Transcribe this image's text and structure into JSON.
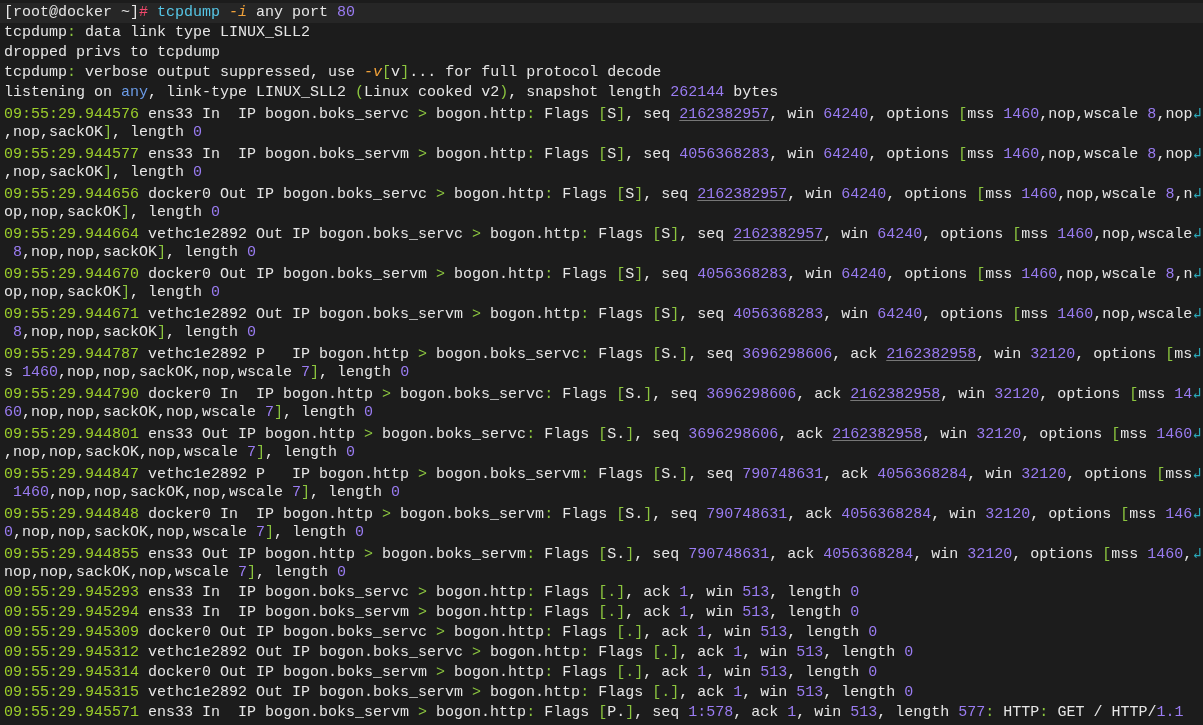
{
  "terminal": {
    "lines": [
      [
        {
          "kind": "plain",
          "text": "[root@docker ~]"
        },
        {
          "kind": "prompt",
          "text": "#"
        },
        {
          "kind": "command",
          "text": " tcpdump"
        },
        {
          "kind": "flag",
          "text": " -i"
        },
        {
          "kind": "plain",
          "text": " any port "
        },
        {
          "kind": "num",
          "text": "80"
        }
      ],
      [
        {
          "kind": "plain",
          "text": "tcpdump"
        },
        {
          "kind": "sym",
          "text": ":"
        },
        {
          "kind": "plain",
          "text": " data link type LINUX_SLL2"
        }
      ],
      [
        {
          "kind": "plain",
          "text": "dropped privs to tcpdump"
        }
      ],
      [
        {
          "kind": "plain",
          "text": "tcpdump"
        },
        {
          "kind": "sym",
          "text": ":"
        },
        {
          "kind": "plain",
          "text": " verbose output suppressed, use "
        },
        {
          "kind": "flag",
          "text": "-v"
        },
        {
          "kind": "sym",
          "text": "["
        },
        {
          "kind": "plain",
          "text": "v"
        },
        {
          "kind": "sym",
          "text": "]"
        },
        {
          "kind": "plain",
          "text": "... for full protocol decode"
        }
      ],
      [
        {
          "kind": "plain",
          "text": "listening on "
        },
        {
          "kind": "keyword",
          "text": "any"
        },
        {
          "kind": "plain",
          "text": ", link-type LINUX_SLL2 "
        },
        {
          "kind": "sym",
          "text": "("
        },
        {
          "kind": "plain",
          "text": "Linux cooked v2"
        },
        {
          "kind": "sym",
          "text": ")"
        },
        {
          "kind": "plain",
          "text": ", snapshot length "
        },
        {
          "kind": "num",
          "text": "262144"
        },
        {
          "kind": "plain",
          "text": " bytes"
        }
      ],
      [
        {
          "kind": "time",
          "text": "09:55:29.944576"
        },
        {
          "kind": "plain",
          "text": " ens33 In  IP bogon.boks_servc "
        },
        {
          "kind": "sym",
          "text": ">"
        },
        {
          "kind": "plain",
          "text": " bogon.http"
        },
        {
          "kind": "sym",
          "text": ":"
        },
        {
          "kind": "plain",
          "text": " Flags "
        },
        {
          "kind": "sym",
          "text": "["
        },
        {
          "kind": "plain",
          "text": "S"
        },
        {
          "kind": "sym",
          "text": "]"
        },
        {
          "kind": "plain",
          "text": ", seq "
        },
        {
          "kind": "link",
          "text": "2162382957"
        },
        {
          "kind": "plain",
          "text": ", win "
        },
        {
          "kind": "num",
          "text": "64240"
        },
        {
          "kind": "plain",
          "text": ", options "
        },
        {
          "kind": "sym",
          "text": "["
        },
        {
          "kind": "plain",
          "text": "mss "
        },
        {
          "kind": "num",
          "text": "1460"
        },
        {
          "kind": "plain",
          "text": ",nop,wscale "
        },
        {
          "kind": "num",
          "text": "8"
        },
        {
          "kind": "plain",
          "text": ",nop"
        },
        {
          "kind": "wrap",
          "text": "↲"
        }
      ],
      [
        {
          "kind": "plain",
          "text": ",nop,sackOK"
        },
        {
          "kind": "sym",
          "text": "]"
        },
        {
          "kind": "plain",
          "text": ", length "
        },
        {
          "kind": "num",
          "text": "0"
        }
      ],
      [
        {
          "kind": "time",
          "text": "09:55:29.944577"
        },
        {
          "kind": "plain",
          "text": " ens33 In  IP bogon.boks_servm "
        },
        {
          "kind": "sym",
          "text": ">"
        },
        {
          "kind": "plain",
          "text": " bogon.http"
        },
        {
          "kind": "sym",
          "text": ":"
        },
        {
          "kind": "plain",
          "text": " Flags "
        },
        {
          "kind": "sym",
          "text": "["
        },
        {
          "kind": "plain",
          "text": "S"
        },
        {
          "kind": "sym",
          "text": "]"
        },
        {
          "kind": "plain",
          "text": ", seq "
        },
        {
          "kind": "num",
          "text": "4056368283"
        },
        {
          "kind": "plain",
          "text": ", win "
        },
        {
          "kind": "num",
          "text": "64240"
        },
        {
          "kind": "plain",
          "text": ", options "
        },
        {
          "kind": "sym",
          "text": "["
        },
        {
          "kind": "plain",
          "text": "mss "
        },
        {
          "kind": "num",
          "text": "1460"
        },
        {
          "kind": "plain",
          "text": ",nop,wscale "
        },
        {
          "kind": "num",
          "text": "8"
        },
        {
          "kind": "plain",
          "text": ",nop"
        },
        {
          "kind": "wrap",
          "text": "↲"
        }
      ],
      [
        {
          "kind": "plain",
          "text": ",nop,sackOK"
        },
        {
          "kind": "sym",
          "text": "]"
        },
        {
          "kind": "plain",
          "text": ", length "
        },
        {
          "kind": "num",
          "text": "0"
        }
      ],
      [
        {
          "kind": "time",
          "text": "09:55:29.944656"
        },
        {
          "kind": "plain",
          "text": " docker0 Out IP bogon.boks_servc "
        },
        {
          "kind": "sym",
          "text": ">"
        },
        {
          "kind": "plain",
          "text": " bogon.http"
        },
        {
          "kind": "sym",
          "text": ":"
        },
        {
          "kind": "plain",
          "text": " Flags "
        },
        {
          "kind": "sym",
          "text": "["
        },
        {
          "kind": "plain",
          "text": "S"
        },
        {
          "kind": "sym",
          "text": "]"
        },
        {
          "kind": "plain",
          "text": ", seq "
        },
        {
          "kind": "link",
          "text": "2162382957"
        },
        {
          "kind": "plain",
          "text": ", win "
        },
        {
          "kind": "num",
          "text": "64240"
        },
        {
          "kind": "plain",
          "text": ", options "
        },
        {
          "kind": "sym",
          "text": "["
        },
        {
          "kind": "plain",
          "text": "mss "
        },
        {
          "kind": "num",
          "text": "1460"
        },
        {
          "kind": "plain",
          "text": ",nop,wscale "
        },
        {
          "kind": "num",
          "text": "8"
        },
        {
          "kind": "plain",
          "text": ",n"
        },
        {
          "kind": "wrap",
          "text": "↲"
        }
      ],
      [
        {
          "kind": "plain",
          "text": "op,nop,sackOK"
        },
        {
          "kind": "sym",
          "text": "]"
        },
        {
          "kind": "plain",
          "text": ", length "
        },
        {
          "kind": "num",
          "text": "0"
        }
      ],
      [
        {
          "kind": "time",
          "text": "09:55:29.944664"
        },
        {
          "kind": "plain",
          "text": " vethc1e2892 Out IP bogon.boks_servc "
        },
        {
          "kind": "sym",
          "text": ">"
        },
        {
          "kind": "plain",
          "text": " bogon.http"
        },
        {
          "kind": "sym",
          "text": ":"
        },
        {
          "kind": "plain",
          "text": " Flags "
        },
        {
          "kind": "sym",
          "text": "["
        },
        {
          "kind": "plain",
          "text": "S"
        },
        {
          "kind": "sym",
          "text": "]"
        },
        {
          "kind": "plain",
          "text": ", seq "
        },
        {
          "kind": "link",
          "text": "2162382957"
        },
        {
          "kind": "plain",
          "text": ", win "
        },
        {
          "kind": "num",
          "text": "64240"
        },
        {
          "kind": "plain",
          "text": ", options "
        },
        {
          "kind": "sym",
          "text": "["
        },
        {
          "kind": "plain",
          "text": "mss "
        },
        {
          "kind": "num",
          "text": "1460"
        },
        {
          "kind": "plain",
          "text": ",nop,wscale"
        },
        {
          "kind": "wrap",
          "text": "↲"
        }
      ],
      [
        {
          "kind": "num",
          "text": " 8"
        },
        {
          "kind": "plain",
          "text": ",nop,nop,sackOK"
        },
        {
          "kind": "sym",
          "text": "]"
        },
        {
          "kind": "plain",
          "text": ", length "
        },
        {
          "kind": "num",
          "text": "0"
        }
      ],
      [
        {
          "kind": "time",
          "text": "09:55:29.944670"
        },
        {
          "kind": "plain",
          "text": " docker0 Out IP bogon.boks_servm "
        },
        {
          "kind": "sym",
          "text": ">"
        },
        {
          "kind": "plain",
          "text": " bogon.http"
        },
        {
          "kind": "sym",
          "text": ":"
        },
        {
          "kind": "plain",
          "text": " Flags "
        },
        {
          "kind": "sym",
          "text": "["
        },
        {
          "kind": "plain",
          "text": "S"
        },
        {
          "kind": "sym",
          "text": "]"
        },
        {
          "kind": "plain",
          "text": ", seq "
        },
        {
          "kind": "num",
          "text": "4056368283"
        },
        {
          "kind": "plain",
          "text": ", win "
        },
        {
          "kind": "num",
          "text": "64240"
        },
        {
          "kind": "plain",
          "text": ", options "
        },
        {
          "kind": "sym",
          "text": "["
        },
        {
          "kind": "plain",
          "text": "mss "
        },
        {
          "kind": "num",
          "text": "1460"
        },
        {
          "kind": "plain",
          "text": ",nop,wscale "
        },
        {
          "kind": "num",
          "text": "8"
        },
        {
          "kind": "plain",
          "text": ",n"
        },
        {
          "kind": "wrap",
          "text": "↲"
        }
      ],
      [
        {
          "kind": "plain",
          "text": "op,nop,sackOK"
        },
        {
          "kind": "sym",
          "text": "]"
        },
        {
          "kind": "plain",
          "text": ", length "
        },
        {
          "kind": "num",
          "text": "0"
        }
      ],
      [
        {
          "kind": "time",
          "text": "09:55:29.944671"
        },
        {
          "kind": "plain",
          "text": " vethc1e2892 Out IP bogon.boks_servm "
        },
        {
          "kind": "sym",
          "text": ">"
        },
        {
          "kind": "plain",
          "text": " bogon.http"
        },
        {
          "kind": "sym",
          "text": ":"
        },
        {
          "kind": "plain",
          "text": " Flags "
        },
        {
          "kind": "sym",
          "text": "["
        },
        {
          "kind": "plain",
          "text": "S"
        },
        {
          "kind": "sym",
          "text": "]"
        },
        {
          "kind": "plain",
          "text": ", seq "
        },
        {
          "kind": "num",
          "text": "4056368283"
        },
        {
          "kind": "plain",
          "text": ", win "
        },
        {
          "kind": "num",
          "text": "64240"
        },
        {
          "kind": "plain",
          "text": ", options "
        },
        {
          "kind": "sym",
          "text": "["
        },
        {
          "kind": "plain",
          "text": "mss "
        },
        {
          "kind": "num",
          "text": "1460"
        },
        {
          "kind": "plain",
          "text": ",nop,wscale"
        },
        {
          "kind": "wrap",
          "text": "↲"
        }
      ],
      [
        {
          "kind": "num",
          "text": " 8"
        },
        {
          "kind": "plain",
          "text": ",nop,nop,sackOK"
        },
        {
          "kind": "sym",
          "text": "]"
        },
        {
          "kind": "plain",
          "text": ", length "
        },
        {
          "kind": "num",
          "text": "0"
        }
      ],
      [
        {
          "kind": "time",
          "text": "09:55:29.944787"
        },
        {
          "kind": "plain",
          "text": " vethc1e2892 P   IP bogon.http "
        },
        {
          "kind": "sym",
          "text": ">"
        },
        {
          "kind": "plain",
          "text": " bogon.boks_servc"
        },
        {
          "kind": "sym",
          "text": ":"
        },
        {
          "kind": "plain",
          "text": " Flags "
        },
        {
          "kind": "sym",
          "text": "["
        },
        {
          "kind": "plain",
          "text": "S."
        },
        {
          "kind": "sym",
          "text": "]"
        },
        {
          "kind": "plain",
          "text": ", seq "
        },
        {
          "kind": "num",
          "text": "3696298606"
        },
        {
          "kind": "plain",
          "text": ", ack "
        },
        {
          "kind": "link",
          "text": "2162382958"
        },
        {
          "kind": "plain",
          "text": ", win "
        },
        {
          "kind": "num",
          "text": "32120"
        },
        {
          "kind": "plain",
          "text": ", options "
        },
        {
          "kind": "sym",
          "text": "["
        },
        {
          "kind": "plain",
          "text": "ms"
        },
        {
          "kind": "wrap",
          "text": "↲"
        }
      ],
      [
        {
          "kind": "plain",
          "text": "s "
        },
        {
          "kind": "num",
          "text": "1460"
        },
        {
          "kind": "plain",
          "text": ",nop,nop,sackOK,nop,wscale "
        },
        {
          "kind": "num",
          "text": "7"
        },
        {
          "kind": "sym",
          "text": "]"
        },
        {
          "kind": "plain",
          "text": ", length "
        },
        {
          "kind": "num",
          "text": "0"
        }
      ],
      [
        {
          "kind": "time",
          "text": "09:55:29.944790"
        },
        {
          "kind": "plain",
          "text": " docker0 In  IP bogon.http "
        },
        {
          "kind": "sym",
          "text": ">"
        },
        {
          "kind": "plain",
          "text": " bogon.boks_servc"
        },
        {
          "kind": "sym",
          "text": ":"
        },
        {
          "kind": "plain",
          "text": " Flags "
        },
        {
          "kind": "sym",
          "text": "["
        },
        {
          "kind": "plain",
          "text": "S."
        },
        {
          "kind": "sym",
          "text": "]"
        },
        {
          "kind": "plain",
          "text": ", seq "
        },
        {
          "kind": "num",
          "text": "3696298606"
        },
        {
          "kind": "plain",
          "text": ", ack "
        },
        {
          "kind": "link",
          "text": "2162382958"
        },
        {
          "kind": "plain",
          "text": ", win "
        },
        {
          "kind": "num",
          "text": "32120"
        },
        {
          "kind": "plain",
          "text": ", options "
        },
        {
          "kind": "sym",
          "text": "["
        },
        {
          "kind": "plain",
          "text": "mss "
        },
        {
          "kind": "num",
          "text": "14"
        },
        {
          "kind": "wrap",
          "text": "↲"
        }
      ],
      [
        {
          "kind": "num",
          "text": "60"
        },
        {
          "kind": "plain",
          "text": ",nop,nop,sackOK,nop,wscale "
        },
        {
          "kind": "num",
          "text": "7"
        },
        {
          "kind": "sym",
          "text": "]"
        },
        {
          "kind": "plain",
          "text": ", length "
        },
        {
          "kind": "num",
          "text": "0"
        }
      ],
      [
        {
          "kind": "time",
          "text": "09:55:29.944801"
        },
        {
          "kind": "plain",
          "text": " ens33 Out IP bogon.http "
        },
        {
          "kind": "sym",
          "text": ">"
        },
        {
          "kind": "plain",
          "text": " bogon.boks_servc"
        },
        {
          "kind": "sym",
          "text": ":"
        },
        {
          "kind": "plain",
          "text": " Flags "
        },
        {
          "kind": "sym",
          "text": "["
        },
        {
          "kind": "plain",
          "text": "S."
        },
        {
          "kind": "sym",
          "text": "]"
        },
        {
          "kind": "plain",
          "text": ", seq "
        },
        {
          "kind": "num",
          "text": "3696298606"
        },
        {
          "kind": "plain",
          "text": ", ack "
        },
        {
          "kind": "link",
          "text": "2162382958"
        },
        {
          "kind": "plain",
          "text": ", win "
        },
        {
          "kind": "num",
          "text": "32120"
        },
        {
          "kind": "plain",
          "text": ", options "
        },
        {
          "kind": "sym",
          "text": "["
        },
        {
          "kind": "plain",
          "text": "mss "
        },
        {
          "kind": "num",
          "text": "1460"
        },
        {
          "kind": "wrap",
          "text": "↲"
        }
      ],
      [
        {
          "kind": "plain",
          "text": ",nop,nop,sackOK,nop,wscale "
        },
        {
          "kind": "num",
          "text": "7"
        },
        {
          "kind": "sym",
          "text": "]"
        },
        {
          "kind": "plain",
          "text": ", length "
        },
        {
          "kind": "num",
          "text": "0"
        }
      ],
      [
        {
          "kind": "time",
          "text": "09:55:29.944847"
        },
        {
          "kind": "plain",
          "text": " vethc1e2892 P   IP bogon.http "
        },
        {
          "kind": "sym",
          "text": ">"
        },
        {
          "kind": "plain",
          "text": " bogon.boks_servm"
        },
        {
          "kind": "sym",
          "text": ":"
        },
        {
          "kind": "plain",
          "text": " Flags "
        },
        {
          "kind": "sym",
          "text": "["
        },
        {
          "kind": "plain",
          "text": "S."
        },
        {
          "kind": "sym",
          "text": "]"
        },
        {
          "kind": "plain",
          "text": ", seq "
        },
        {
          "kind": "num",
          "text": "790748631"
        },
        {
          "kind": "plain",
          "text": ", ack "
        },
        {
          "kind": "num",
          "text": "4056368284"
        },
        {
          "kind": "plain",
          "text": ", win "
        },
        {
          "kind": "num",
          "text": "32120"
        },
        {
          "kind": "plain",
          "text": ", options "
        },
        {
          "kind": "sym",
          "text": "["
        },
        {
          "kind": "plain",
          "text": "mss"
        },
        {
          "kind": "wrap",
          "text": "↲"
        }
      ],
      [
        {
          "kind": "num",
          "text": " 1460"
        },
        {
          "kind": "plain",
          "text": ",nop,nop,sackOK,nop,wscale "
        },
        {
          "kind": "num",
          "text": "7"
        },
        {
          "kind": "sym",
          "text": "]"
        },
        {
          "kind": "plain",
          "text": ", length "
        },
        {
          "kind": "num",
          "text": "0"
        }
      ],
      [
        {
          "kind": "time",
          "text": "09:55:29.944848"
        },
        {
          "kind": "plain",
          "text": " docker0 In  IP bogon.http "
        },
        {
          "kind": "sym",
          "text": ">"
        },
        {
          "kind": "plain",
          "text": " bogon.boks_servm"
        },
        {
          "kind": "sym",
          "text": ":"
        },
        {
          "kind": "plain",
          "text": " Flags "
        },
        {
          "kind": "sym",
          "text": "["
        },
        {
          "kind": "plain",
          "text": "S."
        },
        {
          "kind": "sym",
          "text": "]"
        },
        {
          "kind": "plain",
          "text": ", seq "
        },
        {
          "kind": "num",
          "text": "790748631"
        },
        {
          "kind": "plain",
          "text": ", ack "
        },
        {
          "kind": "num",
          "text": "4056368284"
        },
        {
          "kind": "plain",
          "text": ", win "
        },
        {
          "kind": "num",
          "text": "32120"
        },
        {
          "kind": "plain",
          "text": ", options "
        },
        {
          "kind": "sym",
          "text": "["
        },
        {
          "kind": "plain",
          "text": "mss "
        },
        {
          "kind": "num",
          "text": "146"
        },
        {
          "kind": "wrap",
          "text": "↲"
        }
      ],
      [
        {
          "kind": "num",
          "text": "0"
        },
        {
          "kind": "plain",
          "text": ",nop,nop,sackOK,nop,wscale "
        },
        {
          "kind": "num",
          "text": "7"
        },
        {
          "kind": "sym",
          "text": "]"
        },
        {
          "kind": "plain",
          "text": ", length "
        },
        {
          "kind": "num",
          "text": "0"
        }
      ],
      [
        {
          "kind": "time",
          "text": "09:55:29.944855"
        },
        {
          "kind": "plain",
          "text": " ens33 Out IP bogon.http "
        },
        {
          "kind": "sym",
          "text": ">"
        },
        {
          "kind": "plain",
          "text": " bogon.boks_servm"
        },
        {
          "kind": "sym",
          "text": ":"
        },
        {
          "kind": "plain",
          "text": " Flags "
        },
        {
          "kind": "sym",
          "text": "["
        },
        {
          "kind": "plain",
          "text": "S."
        },
        {
          "kind": "sym",
          "text": "]"
        },
        {
          "kind": "plain",
          "text": ", seq "
        },
        {
          "kind": "num",
          "text": "790748631"
        },
        {
          "kind": "plain",
          "text": ", ack "
        },
        {
          "kind": "num",
          "text": "4056368284"
        },
        {
          "kind": "plain",
          "text": ", win "
        },
        {
          "kind": "num",
          "text": "32120"
        },
        {
          "kind": "plain",
          "text": ", options "
        },
        {
          "kind": "sym",
          "text": "["
        },
        {
          "kind": "plain",
          "text": "mss "
        },
        {
          "kind": "num",
          "text": "1460"
        },
        {
          "kind": "plain",
          "text": ","
        },
        {
          "kind": "wrap",
          "text": "↲"
        }
      ],
      [
        {
          "kind": "plain",
          "text": "nop,nop,sackOK,nop,wscale "
        },
        {
          "kind": "num",
          "text": "7"
        },
        {
          "kind": "sym",
          "text": "]"
        },
        {
          "kind": "plain",
          "text": ", length "
        },
        {
          "kind": "num",
          "text": "0"
        }
      ],
      [
        {
          "kind": "time",
          "text": "09:55:29.945293"
        },
        {
          "kind": "plain",
          "text": " ens33 In  IP bogon.boks_servc "
        },
        {
          "kind": "sym",
          "text": ">"
        },
        {
          "kind": "plain",
          "text": " bogon.http"
        },
        {
          "kind": "sym",
          "text": ":"
        },
        {
          "kind": "plain",
          "text": " Flags "
        },
        {
          "kind": "sym",
          "text": "[.]"
        },
        {
          "kind": "plain",
          "text": ", ack "
        },
        {
          "kind": "num",
          "text": "1"
        },
        {
          "kind": "plain",
          "text": ", win "
        },
        {
          "kind": "num",
          "text": "513"
        },
        {
          "kind": "plain",
          "text": ", length "
        },
        {
          "kind": "num",
          "text": "0"
        }
      ],
      [
        {
          "kind": "time",
          "text": "09:55:29.945294"
        },
        {
          "kind": "plain",
          "text": " ens33 In  IP bogon.boks_servm "
        },
        {
          "kind": "sym",
          "text": ">"
        },
        {
          "kind": "plain",
          "text": " bogon.http"
        },
        {
          "kind": "sym",
          "text": ":"
        },
        {
          "kind": "plain",
          "text": " Flags "
        },
        {
          "kind": "sym",
          "text": "[.]"
        },
        {
          "kind": "plain",
          "text": ", ack "
        },
        {
          "kind": "num",
          "text": "1"
        },
        {
          "kind": "plain",
          "text": ", win "
        },
        {
          "kind": "num",
          "text": "513"
        },
        {
          "kind": "plain",
          "text": ", length "
        },
        {
          "kind": "num",
          "text": "0"
        }
      ],
      [
        {
          "kind": "time",
          "text": "09:55:29.945309"
        },
        {
          "kind": "plain",
          "text": " docker0 Out IP bogon.boks_servc "
        },
        {
          "kind": "sym",
          "text": ">"
        },
        {
          "kind": "plain",
          "text": " bogon.http"
        },
        {
          "kind": "sym",
          "text": ":"
        },
        {
          "kind": "plain",
          "text": " Flags "
        },
        {
          "kind": "sym",
          "text": "[.]"
        },
        {
          "kind": "plain",
          "text": ", ack "
        },
        {
          "kind": "num",
          "text": "1"
        },
        {
          "kind": "plain",
          "text": ", win "
        },
        {
          "kind": "num",
          "text": "513"
        },
        {
          "kind": "plain",
          "text": ", length "
        },
        {
          "kind": "num",
          "text": "0"
        }
      ],
      [
        {
          "kind": "time",
          "text": "09:55:29.945312"
        },
        {
          "kind": "plain",
          "text": " vethc1e2892 Out IP bogon.boks_servc "
        },
        {
          "kind": "sym",
          "text": ">"
        },
        {
          "kind": "plain",
          "text": " bogon.http"
        },
        {
          "kind": "sym",
          "text": ":"
        },
        {
          "kind": "plain",
          "text": " Flags "
        },
        {
          "kind": "sym",
          "text": "[.]"
        },
        {
          "kind": "plain",
          "text": ", ack "
        },
        {
          "kind": "num",
          "text": "1"
        },
        {
          "kind": "plain",
          "text": ", win "
        },
        {
          "kind": "num",
          "text": "513"
        },
        {
          "kind": "plain",
          "text": ", length "
        },
        {
          "kind": "num",
          "text": "0"
        }
      ],
      [
        {
          "kind": "time",
          "text": "09:55:29.945314"
        },
        {
          "kind": "plain",
          "text": " docker0 Out IP bogon.boks_servm "
        },
        {
          "kind": "sym",
          "text": ">"
        },
        {
          "kind": "plain",
          "text": " bogon.http"
        },
        {
          "kind": "sym",
          "text": ":"
        },
        {
          "kind": "plain",
          "text": " Flags "
        },
        {
          "kind": "sym",
          "text": "[.]"
        },
        {
          "kind": "plain",
          "text": ", ack "
        },
        {
          "kind": "num",
          "text": "1"
        },
        {
          "kind": "plain",
          "text": ", win "
        },
        {
          "kind": "num",
          "text": "513"
        },
        {
          "kind": "plain",
          "text": ", length "
        },
        {
          "kind": "num",
          "text": "0"
        }
      ],
      [
        {
          "kind": "time",
          "text": "09:55:29.945315"
        },
        {
          "kind": "plain",
          "text": " vethc1e2892 Out IP bogon.boks_servm "
        },
        {
          "kind": "sym",
          "text": ">"
        },
        {
          "kind": "plain",
          "text": " bogon.http"
        },
        {
          "kind": "sym",
          "text": ":"
        },
        {
          "kind": "plain",
          "text": " Flags "
        },
        {
          "kind": "sym",
          "text": "[.]"
        },
        {
          "kind": "plain",
          "text": ", ack "
        },
        {
          "kind": "num",
          "text": "1"
        },
        {
          "kind": "plain",
          "text": ", win "
        },
        {
          "kind": "num",
          "text": "513"
        },
        {
          "kind": "plain",
          "text": ", length "
        },
        {
          "kind": "num",
          "text": "0"
        }
      ],
      [
        {
          "kind": "time",
          "text": "09:55:29.945571"
        },
        {
          "kind": "plain",
          "text": " ens33 In  IP bogon.boks_servm "
        },
        {
          "kind": "sym",
          "text": ">"
        },
        {
          "kind": "plain",
          "text": " bogon.http"
        },
        {
          "kind": "sym",
          "text": ":"
        },
        {
          "kind": "plain",
          "text": " Flags "
        },
        {
          "kind": "sym",
          "text": "["
        },
        {
          "kind": "plain",
          "text": "P."
        },
        {
          "kind": "sym",
          "text": "]"
        },
        {
          "kind": "plain",
          "text": ", seq "
        },
        {
          "kind": "num",
          "text": "1:578"
        },
        {
          "kind": "plain",
          "text": ", ack "
        },
        {
          "kind": "num",
          "text": "1"
        },
        {
          "kind": "plain",
          "text": ", win "
        },
        {
          "kind": "num",
          "text": "513"
        },
        {
          "kind": "plain",
          "text": ", length "
        },
        {
          "kind": "num",
          "text": "577"
        },
        {
          "kind": "sym",
          "text": ":"
        },
        {
          "kind": "plain",
          "text": " HTTP"
        },
        {
          "kind": "sym",
          "text": ":"
        },
        {
          "kind": "plain",
          "text": " GET / HTTP/"
        },
        {
          "kind": "num",
          "text": "1.1"
        }
      ]
    ]
  }
}
